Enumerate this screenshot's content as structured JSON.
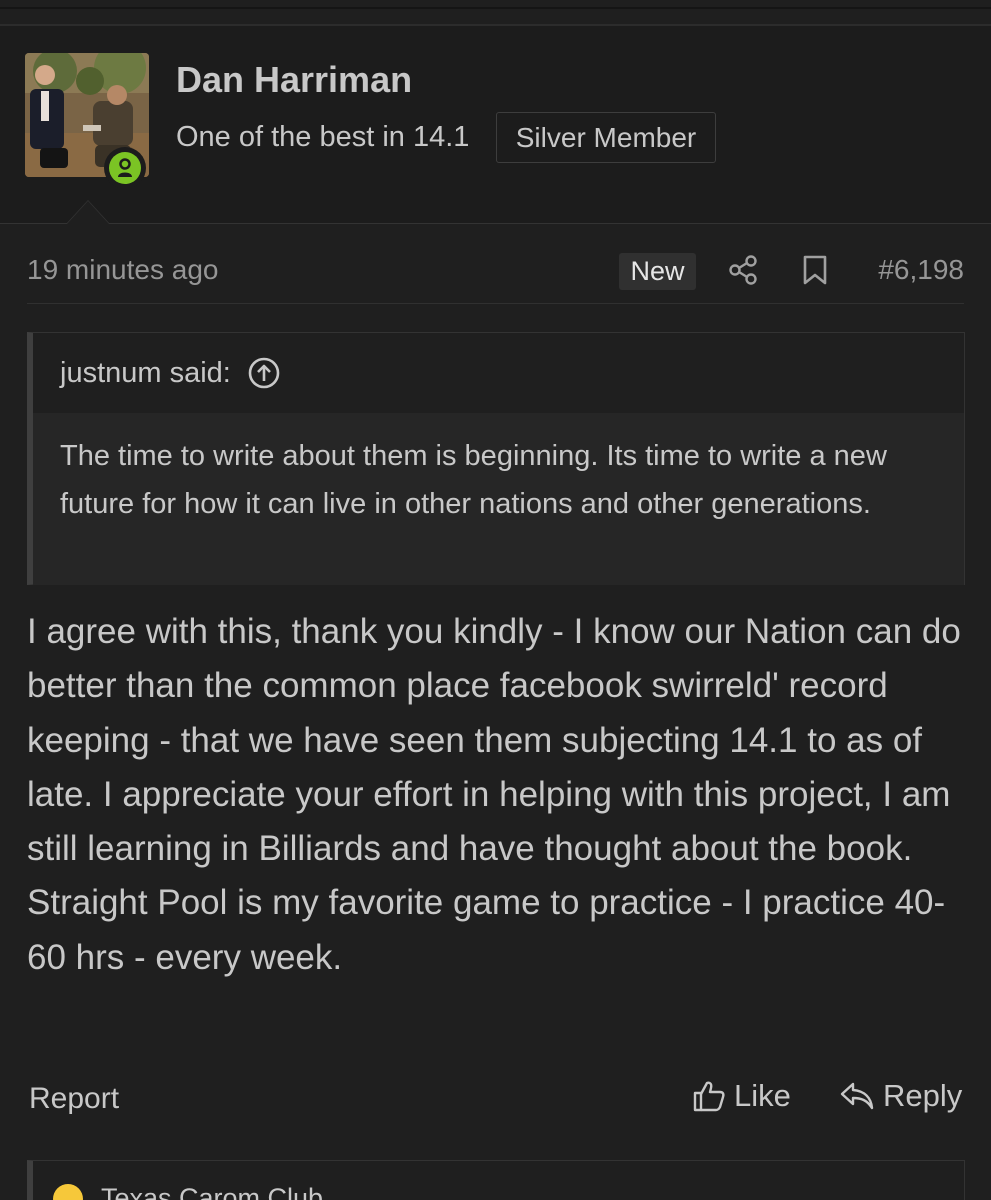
{
  "author": {
    "name": "Dan Harriman",
    "title": "One of the best in 14.1",
    "badge": "Silver Member",
    "online": true
  },
  "post": {
    "timestamp": "19 minutes ago",
    "new_label": "New",
    "number": "#6,198"
  },
  "quote": {
    "attribution": "justnum said:",
    "text": "The time to write about them is beginning. Its time to write a new future for how it can live in other nations and other generations."
  },
  "message": "I agree with this, thank you kindly - I know our Nation can do better than the common place facebook swirreld' record keeping - that we have seen them subjecting 14.1 to as of late. I appreciate your effort in helping with this project, I am still learning in Billiards and have thought about the book. Straight Pool is my favorite game to practice - I practice 40-60 hrs - every week.",
  "actions": {
    "report": "Report",
    "like": "Like",
    "reply": "Reply"
  },
  "next_item": {
    "title": "Texas Carom Club"
  },
  "icons": {
    "online": "person-icon",
    "share": "share-icon",
    "bookmark": "bookmark-icon",
    "quote_jump": "arrow-up-circle-icon",
    "like": "thumbs-up-icon",
    "reply": "reply-icon",
    "emoji": "laughing-emoji-icon"
  },
  "colors": {
    "background": "#1f1f1f",
    "text": "#c8c8c8",
    "muted": "#969696",
    "online": "#7bc424"
  }
}
